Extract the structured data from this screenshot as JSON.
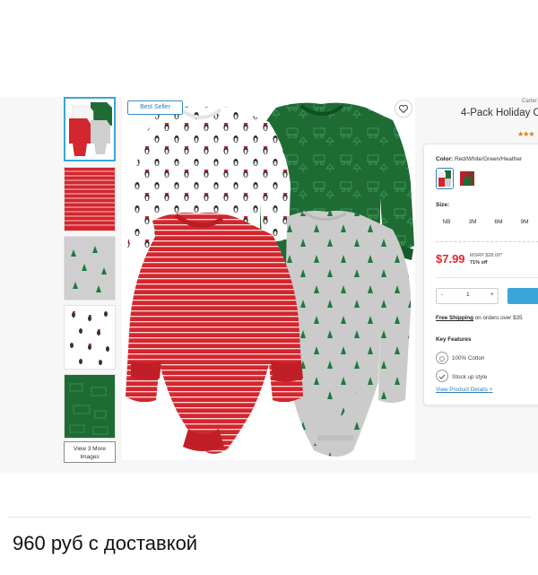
{
  "product": {
    "brand": "Carter",
    "title": "4-Pack Holiday C",
    "badge": "Best Seller",
    "rating_stars": "★★★",
    "color_label": "Color:",
    "color_value": "Red/White/Green/Heather",
    "size_label": "Size:",
    "sizes": [
      "NB",
      "3M",
      "6M",
      "9M"
    ],
    "price": "$7.99",
    "msrp": "MSRP $28.00*",
    "discount": "71% off",
    "quantity": "1",
    "qty_minus": "-",
    "qty_plus": "+",
    "shipping_bold": "Free Shipping",
    "shipping_rest": " on orders over $35",
    "key_features_label": "Key Features",
    "features": [
      "100% Cotton",
      "Stock up style"
    ],
    "view_details": "View Product Details",
    "view_details_arrow": "+"
  },
  "gallery": {
    "view_more_label": "View 3 More Images"
  },
  "post": {
    "caption": "960 руб с доставкой"
  },
  "colors": {
    "accent": "#3aa6d9",
    "price_red": "#e4262d",
    "link_blue": "#2f7fbf",
    "onesie_red": "#d3262e",
    "onesie_green": "#1f6b34",
    "onesie_gray": "#c9c9c9"
  },
  "icons": [
    "heart-icon",
    "cotton-icon",
    "stock-up-icon"
  ]
}
